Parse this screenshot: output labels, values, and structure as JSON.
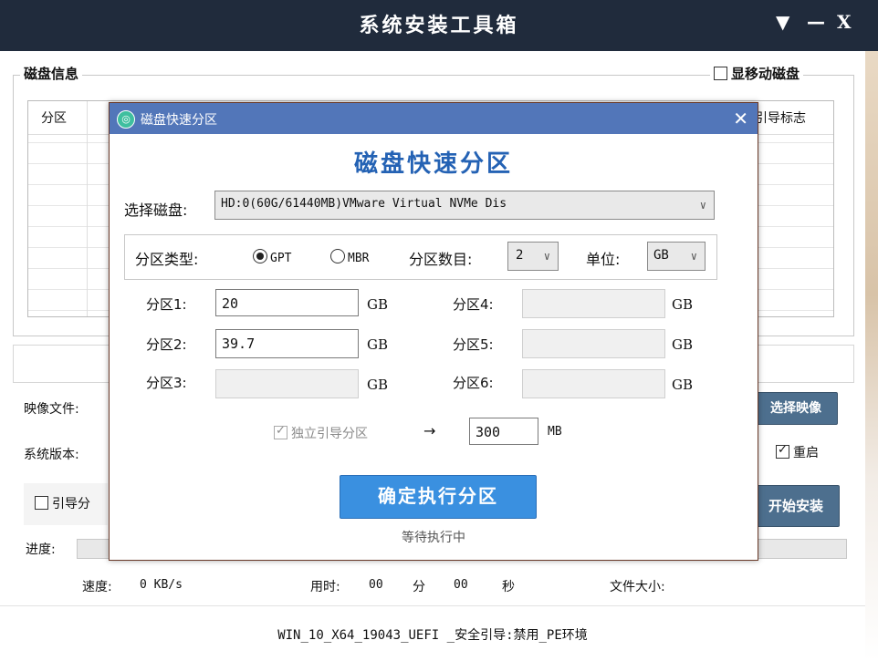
{
  "window": {
    "title": "系统安装工具箱",
    "menu_glyph": "▼",
    "min_glyph": "—",
    "close_glyph": "X"
  },
  "disk_info": {
    "legend": "磁盘信息",
    "show_removable_label": "显移动磁盘",
    "show_removable_checked": false,
    "columns": [
      "分区",
      "引导标志"
    ]
  },
  "image_file": {
    "label": "映像文件:",
    "choose_label": "选择映像"
  },
  "sys_version": {
    "label": "系统版本:"
  },
  "reboot": {
    "label": "重启",
    "checked": true
  },
  "boot_partition": {
    "label": "引导分",
    "checked": false
  },
  "install": {
    "label": "开始安装"
  },
  "progress": {
    "label": "进度:",
    "percent": 0
  },
  "stats": {
    "speed_label": "速度:",
    "speed_value": "0 KB/s",
    "time_label": "用时:",
    "time_min": "00",
    "min_unit": "分",
    "time_sec": "00",
    "sec_unit": "秒",
    "size_label": "文件大小:"
  },
  "status_line": "WIN_10_X64_19043_UEFI _安全引导:禁用_PE环境",
  "dialog": {
    "title": "磁盘快速分区",
    "close_glyph": "✕",
    "heading": "磁盘快速分区",
    "select_disk_label": "选择磁盘:",
    "select_disk_value": "HD:0(60G/61440MB)VMware Virtual NVMe Dis",
    "partition_type_label": "分区类型:",
    "gpt_label": "GPT",
    "mbr_label": "MBR",
    "selected_type": "GPT",
    "partition_count_label": "分区数目:",
    "partition_count_value": "2",
    "unit_label": "单位:",
    "unit_value": "GB",
    "partitions": [
      {
        "label": "分区1:",
        "value": "20",
        "unit": "GB"
      },
      {
        "label": "分区2:",
        "value": "39.7",
        "unit": "GB"
      },
      {
        "label": "分区3:",
        "value": "",
        "unit": "GB"
      },
      {
        "label": "分区4:",
        "value": "",
        "unit": "GB"
      },
      {
        "label": "分区5:",
        "value": "",
        "unit": "GB"
      },
      {
        "label": "分区6:",
        "value": "",
        "unit": "GB"
      }
    ],
    "independent_boot_label": "独立引导分区",
    "independent_boot_checked": true,
    "arrow": "→",
    "boot_size_value": "300",
    "boot_size_unit": "MB",
    "execute_label": "确定执行分区",
    "status": "等待执行中"
  }
}
